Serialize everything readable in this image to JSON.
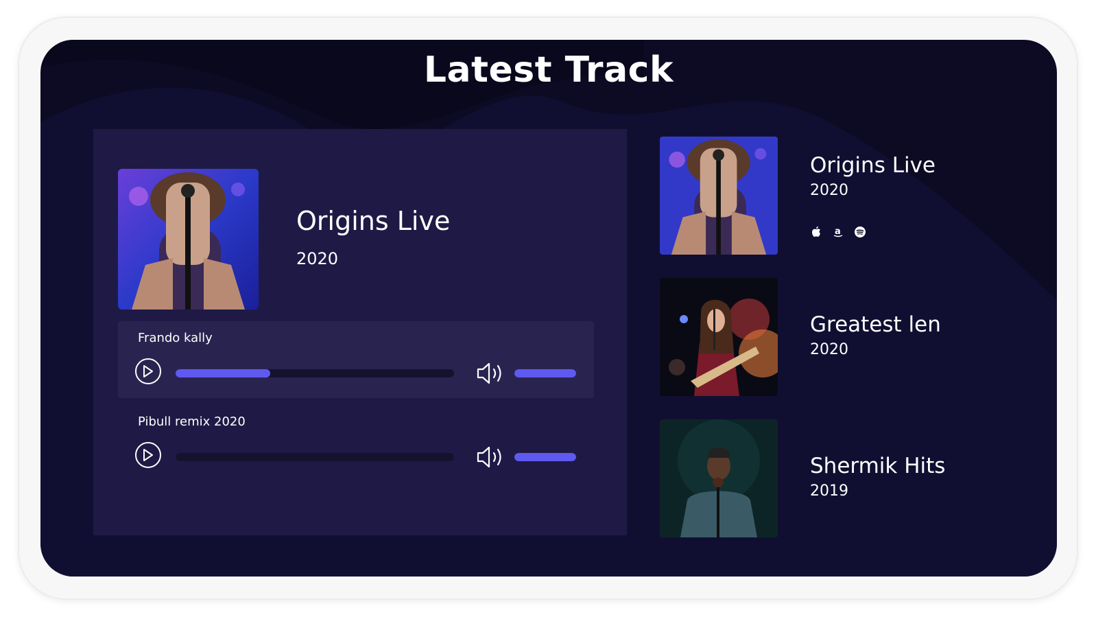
{
  "section": {
    "title": "Latest Track"
  },
  "featured": {
    "title": "Origins Live",
    "year": "2020"
  },
  "tracks": [
    {
      "name": "Frando kally",
      "progress": 0.34,
      "volume": 1.0,
      "active": true
    },
    {
      "name": "Pibull remix 2020",
      "progress": 0.0,
      "volume": 1.0,
      "active": false
    }
  ],
  "releases": [
    {
      "title": "Origins Live",
      "year": "2020",
      "links": [
        "apple-icon",
        "amazon-icon",
        "spotify-icon"
      ]
    },
    {
      "title": "Greatest len",
      "year": "2020"
    },
    {
      "title": "Shermik Hits",
      "year": "2019"
    }
  ],
  "colors": {
    "accent": "#6059f0",
    "background": "#0d0a24",
    "card": "#1e1a45"
  }
}
